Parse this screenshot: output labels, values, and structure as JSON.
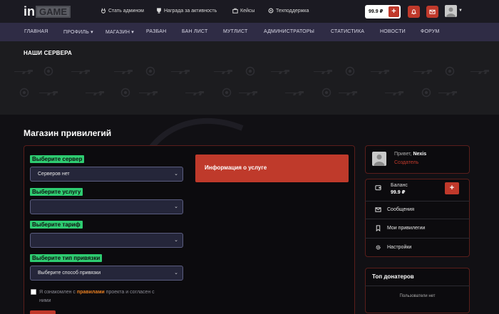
{
  "brand": {
    "logo_in": "in",
    "logo_game": "GAME"
  },
  "toplinks": [
    {
      "label": "Стать админом",
      "icon": "plug-icon"
    },
    {
      "label": "Награда за активность",
      "icon": "trophy-icon"
    },
    {
      "label": "Кейсы",
      "icon": "case-icon"
    },
    {
      "label": "Техподдержка",
      "icon": "support-icon"
    }
  ],
  "topbar": {
    "balance": "99.9 ₽",
    "plus": "+"
  },
  "nav": [
    "ГЛАВНАЯ",
    "ПРОФИЛЬ",
    "МАГАЗИН",
    "РАЗБАН",
    "БАН ЛИСТ",
    "МУТЛИСТ",
    "АДМИНИСТРАТОРЫ",
    "СТАТИСТИКА",
    "НОВОСТИ",
    "ФОРУМ"
  ],
  "banner": {
    "title": "НАШИ СЕРВЕРА"
  },
  "page": {
    "title": "Магазин привилегий"
  },
  "form": {
    "server_label": "Выберите сервер",
    "server_value": "Серверов нет",
    "service_label": "Выберите услугу",
    "service_value": "",
    "tariff_label": "Выберите тариф",
    "tariff_value": "",
    "bind_label": "Выберите тип привязки",
    "bind_value": "Выберите способ привязки",
    "agree_prefix": "Я ознакомлен с ",
    "agree_link": "правилами",
    "agree_suffix": " проекта и согласен с",
    "agree_line2": "ними"
  },
  "info": {
    "label": "Информация о услуге"
  },
  "profile": {
    "greeting": "Привет,",
    "name": "Nexis",
    "role": "Создатель"
  },
  "sidebar": {
    "balance_label": "Баланс",
    "balance_value": "99.9 ₽",
    "plus": "+",
    "items": [
      {
        "label": "Сообщения",
        "icon": "envelope-icon"
      },
      {
        "label": "Мои привилегии",
        "icon": "bookmark-icon"
      },
      {
        "label": "Настройки",
        "icon": "gear-icon"
      }
    ]
  },
  "donors": {
    "title": "Топ донатеров",
    "empty": "Пользователи нет"
  },
  "colors": {
    "accent": "#c0392b",
    "nav_bg": "#2f2c45",
    "label_green": "#2ecc71",
    "card_border": "#5a1e1b"
  }
}
